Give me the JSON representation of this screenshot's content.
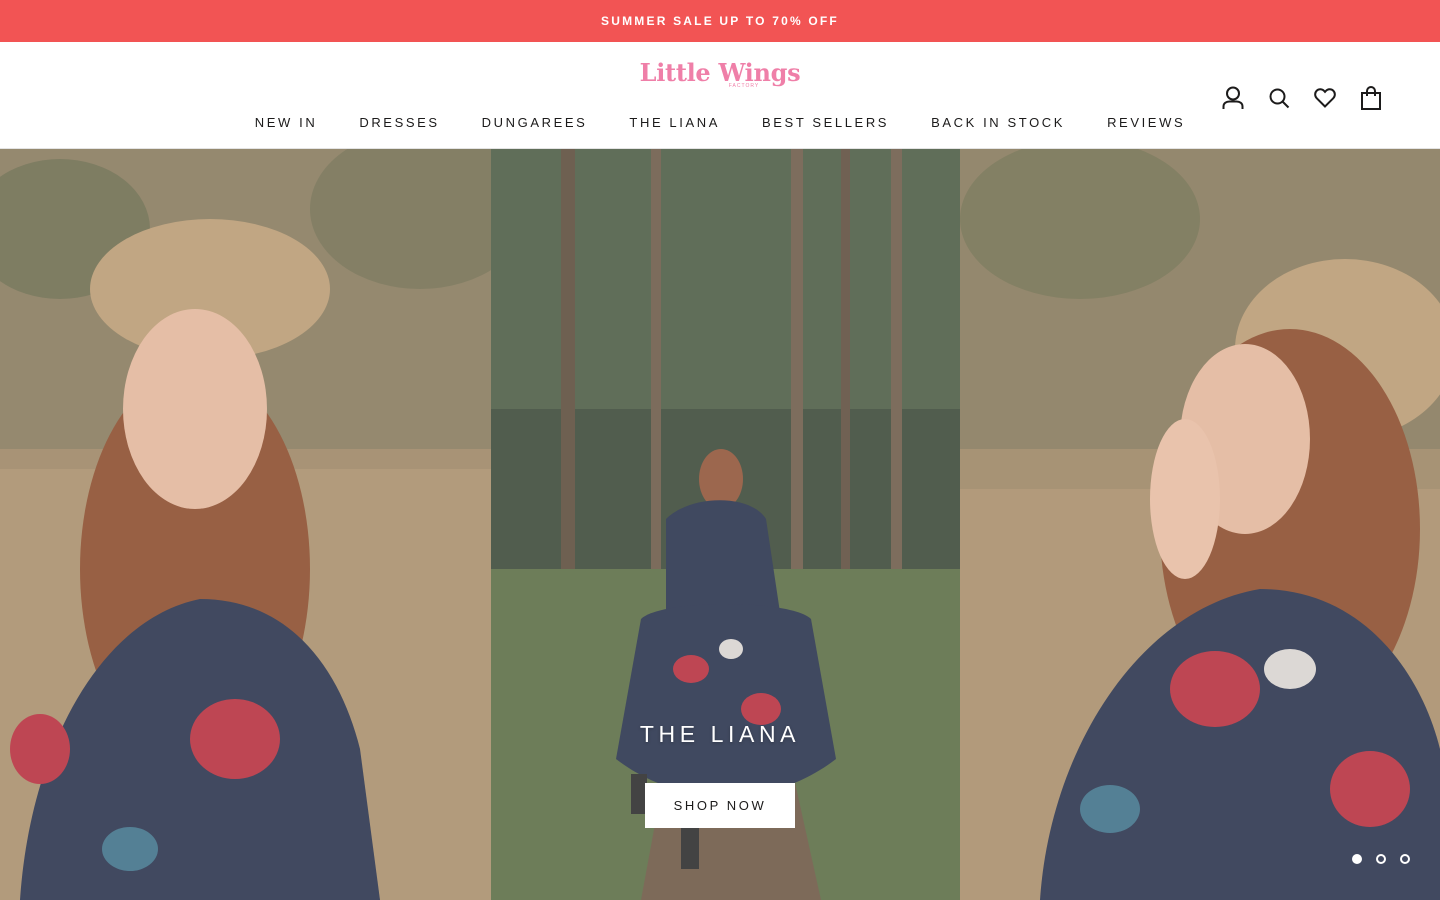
{
  "announcement": {
    "text": "SUMMER SALE UP TO 70% OFF",
    "bg_color": "#f25454"
  },
  "header": {
    "logo": {
      "word": "Little Wings",
      "subtext": "FACTORY",
      "color": "#ef7fa8"
    },
    "actions": [
      {
        "icon": "account-icon"
      },
      {
        "icon": "search-icon"
      },
      {
        "icon": "heart-icon"
      },
      {
        "icon": "shopping-bag-icon"
      }
    ]
  },
  "nav": {
    "items": [
      {
        "label": "NEW IN"
      },
      {
        "label": "DRESSES"
      },
      {
        "label": "DUNGAREES"
      },
      {
        "label": "THE LIANA"
      },
      {
        "label": "BEST SELLERS"
      },
      {
        "label": "BACK IN STOCK"
      },
      {
        "label": "REVIEWS"
      }
    ]
  },
  "hero": {
    "title": "THE LIANA",
    "button_label": "SHOP NOW",
    "slides": {
      "count": 3,
      "active_index": 0
    }
  }
}
